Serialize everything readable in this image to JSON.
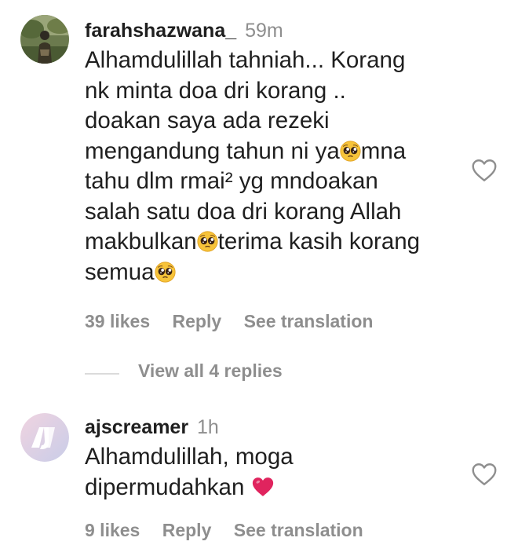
{
  "comments": [
    {
      "username": "farahshazwana_",
      "time": "59m",
      "text_lines": [
        "Alhamdulillah tahniah... Korang",
        "nk minta doa dri korang ..",
        "doakan saya ada rezeki",
        "mengandung tahun ni ya",
        "mna",
        "tahu dlm rmai² yg mndoakan",
        "salah satu doa dri korang Allah",
        "makbulkan",
        "terima kasih korang",
        "semua"
      ],
      "likes": "39 likes",
      "reply_label": "Reply",
      "translate_label": "See translation",
      "avatar_icon": "profile-photo",
      "heart_icon": "heart-outline-icon"
    },
    {
      "username": "ajscreamer",
      "time": "1h",
      "text_lines": [
        "Alhamdulillah, moga",
        "dipermudahkan"
      ],
      "likes": "9 likes",
      "reply_label": "Reply",
      "translate_label": "See translation",
      "avatar_icon": "aj-logo-avatar",
      "avatar_logo_text": "AJ",
      "heart_icon": "heart-outline-icon"
    }
  ],
  "view_replies_label": "View all 4 replies",
  "emoji": {
    "pleading_face": "pleading-face-emoji",
    "red_heart": "red-heart-emoji"
  },
  "colors": {
    "text": "#1f1f1f",
    "secondary": "#8e8e8e",
    "divider": "#dbdbdb",
    "heart_red": "#e0245e"
  }
}
